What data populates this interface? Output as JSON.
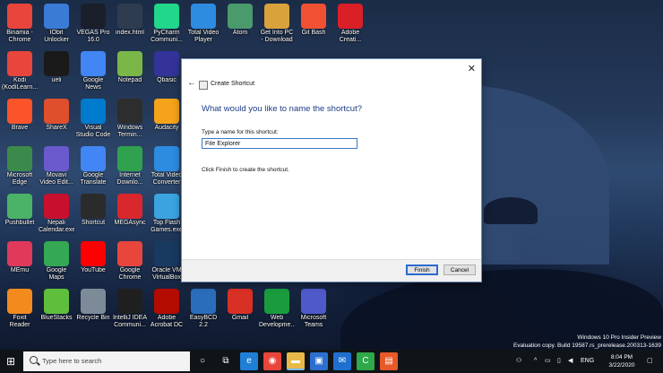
{
  "desktop_icons": [
    {
      "label": "Binamia - Chrome",
      "icon": "chrome-icon",
      "color": "#e8453c"
    },
    {
      "label": "IObit Unlocker",
      "icon": "unlocker-icon",
      "color": "#3a7bd5"
    },
    {
      "label": "VEGAS Pro 16.0",
      "icon": "vegas-icon",
      "color": "#1b1f2a"
    },
    {
      "label": "index.html",
      "icon": "html-file-icon",
      "color": "#2f3b4f"
    },
    {
      "label": "PyCharm Communi...",
      "icon": "pycharm-icon",
      "color": "#21d789"
    },
    {
      "label": "Total Video Player",
      "icon": "video-player-icon",
      "color": "#2d8be0"
    },
    {
      "label": "Atom",
      "icon": "atom-icon",
      "color": "#4a9a6b"
    },
    {
      "label": "Get Into PC - Download ...",
      "icon": "getintopc-icon",
      "color": "#d9a23a"
    },
    {
      "label": "Git Bash",
      "icon": "git-bash-icon",
      "color": "#f05133"
    },
    {
      "label": "Adobe Creati...",
      "icon": "adobe-cc-icon",
      "color": "#da1f26"
    },
    {
      "label": "Kodi (KodiLearn...)",
      "icon": "kodi-icon",
      "color": "#e8453c"
    },
    {
      "label": "ueli",
      "icon": "ueli-icon",
      "color": "#1a1a1a"
    },
    {
      "label": "Google News",
      "icon": "google-news-icon",
      "color": "#4285f4"
    },
    {
      "label": "Notepad",
      "icon": "notepad-icon",
      "color": "#7ab648"
    },
    {
      "label": "Qbasic",
      "icon": "qbasic-icon",
      "color": "#333399"
    },
    {
      "label": "Brave",
      "icon": "brave-icon",
      "color": "#fb542b"
    },
    {
      "label": "ShareX",
      "icon": "sharex-icon",
      "color": "#e04f2c"
    },
    {
      "label": "Visual Studio Code",
      "icon": "vscode-icon",
      "color": "#007acc"
    },
    {
      "label": "Windows Termin...",
      "icon": "terminal-icon",
      "color": "#2d2d2d"
    },
    {
      "label": "Audacity",
      "icon": "audacity-icon",
      "color": "#f5a31a"
    },
    {
      "label": "Microsoft Edge Canary",
      "icon": "edge-canary-icon",
      "color": "#3b8a4c"
    },
    {
      "label": "Movavi Video Edit...",
      "icon": "movavi-icon",
      "color": "#6a5acd"
    },
    {
      "label": "Google Translate",
      "icon": "google-translate-icon",
      "color": "#4285f4"
    },
    {
      "label": "Internet Downlo...",
      "icon": "idm-icon",
      "color": "#30a14e"
    },
    {
      "label": "Total Video Converter",
      "icon": "video-converter-icon",
      "color": "#2d8be0"
    },
    {
      "label": "Pushbullet",
      "icon": "pushbullet-icon",
      "color": "#4ab367"
    },
    {
      "label": "Nepali Calendar.exe",
      "icon": "nepali-calendar-icon",
      "color": "#c8102e"
    },
    {
      "label": "Shortcut",
      "icon": "shortcut-icon",
      "color": "#2b2b2b"
    },
    {
      "label": "MEGAsync",
      "icon": "megasync-icon",
      "color": "#d9272e"
    },
    {
      "label": "Top Flash Games.exe",
      "icon": "flash-games-icon",
      "color": "#3ba4e0"
    },
    {
      "label": "MEmu",
      "icon": "memu-icon",
      "color": "#e0395a"
    },
    {
      "label": "Google Maps",
      "icon": "google-maps-icon",
      "color": "#34a853"
    },
    {
      "label": "YouTube",
      "icon": "youtube-icon",
      "color": "#ff0000"
    },
    {
      "label": "Google Chrome",
      "icon": "chrome-icon",
      "color": "#e8453c"
    },
    {
      "label": "Oracle VM VirtualBox",
      "icon": "virtualbox-icon",
      "color": "#183a61"
    },
    {
      "label": "Foxit Reader",
      "icon": "foxit-icon",
      "color": "#f28a1e"
    },
    {
      "label": "BlueStacks",
      "icon": "bluestacks-icon",
      "color": "#5fbf3c"
    },
    {
      "label": "Recycle Bin",
      "icon": "recycle-bin-icon",
      "color": "#7d8b99"
    },
    {
      "label": "IntelliJ IDEA Communi...",
      "icon": "intellij-icon",
      "color": "#1f1f1f"
    },
    {
      "label": "Adobe Acrobat DC",
      "icon": "acrobat-icon",
      "color": "#b30b00"
    },
    {
      "label": "EasyBCD 2.2",
      "icon": "easybcd-icon",
      "color": "#2a6ebb"
    },
    {
      "label": "Gmail",
      "icon": "gmail-icon",
      "color": "#d93025"
    },
    {
      "label": "Web Developme...",
      "icon": "web-dev-icon",
      "color": "#1a9c3e"
    },
    {
      "label": "Microsoft Teams",
      "icon": "teams-icon",
      "color": "#5059c9"
    }
  ],
  "dialog": {
    "title": "Create Shortcut",
    "heading": "What would you like to name the shortcut?",
    "field_label": "Type a name for this shortcut:",
    "field_value": "File Explorer",
    "instructions": "Click Finish to create the shortcut.",
    "finish_label": "Finish",
    "cancel_label": "Cancel",
    "close_glyph": "✕",
    "back_glyph": "←"
  },
  "watermark": {
    "line1": "Windows 10 Pro Insider Preview",
    "line2": "Evaluation copy. Build 19587.rs_prerelease.200313-1639"
  },
  "taskbar": {
    "start_glyph": "⊞",
    "search_placeholder": "Type here to search",
    "apps": [
      {
        "icon": "cortana-icon",
        "glyph": "○",
        "color": "#101418",
        "active": false
      },
      {
        "icon": "task-view-icon",
        "glyph": "⧉",
        "color": "#101418",
        "active": false
      },
      {
        "icon": "edge-icon",
        "glyph": "e",
        "color": "#1f7fd6",
        "active": false
      },
      {
        "icon": "chrome-icon",
        "glyph": "◉",
        "color": "#e8453c",
        "active": false
      },
      {
        "icon": "file-explorer-icon",
        "glyph": "▬",
        "color": "#e6b94a",
        "active": true
      },
      {
        "icon": "store-icon",
        "glyph": "▣",
        "color": "#2b6fd1",
        "active": false
      },
      {
        "icon": "mail-icon",
        "glyph": "✉",
        "color": "#1f6fcf",
        "active": false
      },
      {
        "icon": "camtasia-icon",
        "glyph": "C",
        "color": "#2fa84a",
        "active": false
      },
      {
        "icon": "app-icon",
        "glyph": "▤",
        "color": "#e8592a",
        "active": false
      }
    ],
    "tray": {
      "language": "ENG",
      "time": "8:04 PM",
      "date": "3/22/2020"
    }
  }
}
